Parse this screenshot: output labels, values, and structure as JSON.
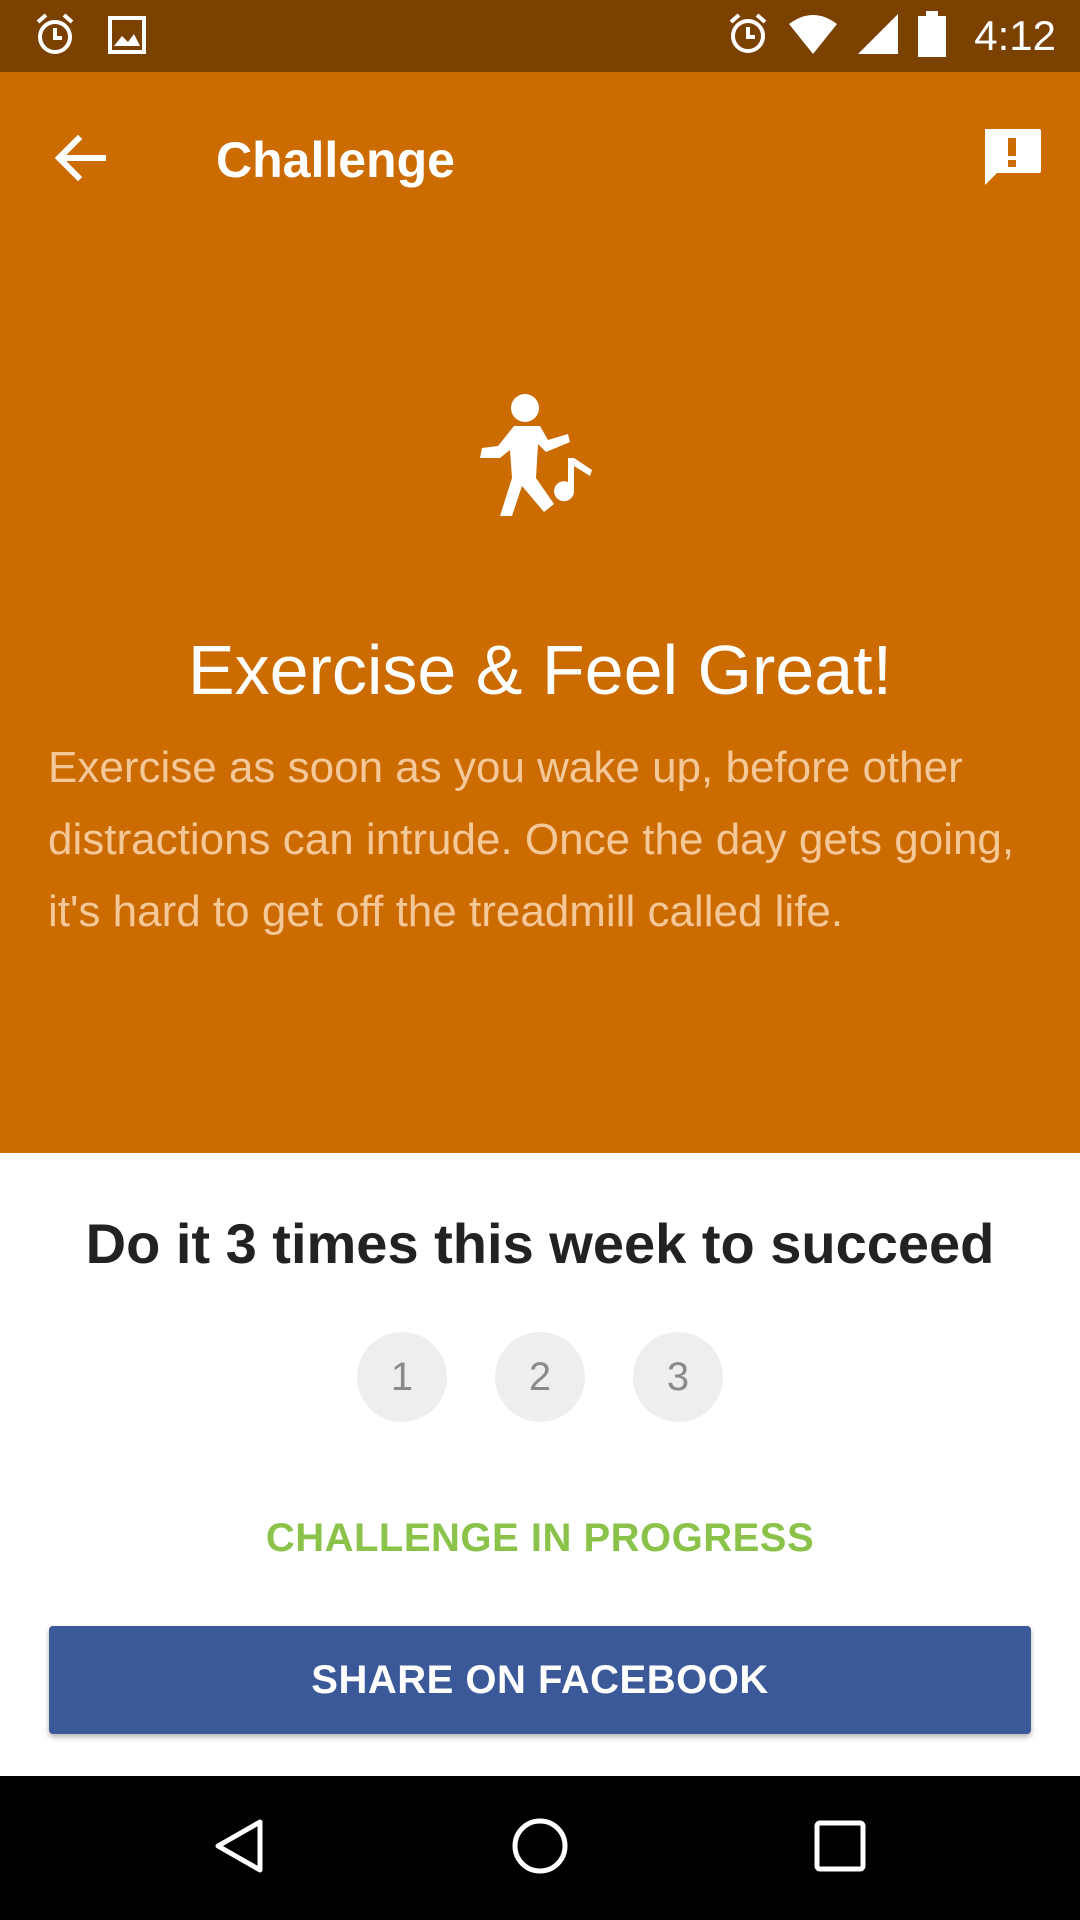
{
  "status_bar": {
    "time": "4:12",
    "left_icons": [
      "alarm-notification-icon",
      "image-notification-icon"
    ],
    "right_icons": [
      "alarm-icon",
      "wifi-icon",
      "cell-signal-icon",
      "battery-icon"
    ]
  },
  "app_bar": {
    "title": "Challenge",
    "back_icon": "arrow-back-icon",
    "feedback_icon": "feedback-icon"
  },
  "challenge": {
    "icon": "dancing-person-icon",
    "title": "Exercise & Feel Great!",
    "description": "Exercise as soon as you wake up, before other distractions can intrude. Once the day gets going, it's hard to get off the treadmill called life.",
    "goal": "Do it 3 times this week to succeed",
    "steps": [
      "1",
      "2",
      "3"
    ],
    "status": "CHALLENGE IN PROGRESS"
  },
  "share_button": {
    "label": "SHARE ON FACEBOOK"
  },
  "nav_bar": {
    "buttons": [
      "back-icon",
      "home-icon",
      "recents-icon"
    ]
  },
  "colors": {
    "status_bar": "#7a4100",
    "hero_bg": "#cc6b00",
    "description_text": "#f5c89a",
    "status_green": "#8bc34a",
    "facebook_blue": "#3b5998"
  }
}
